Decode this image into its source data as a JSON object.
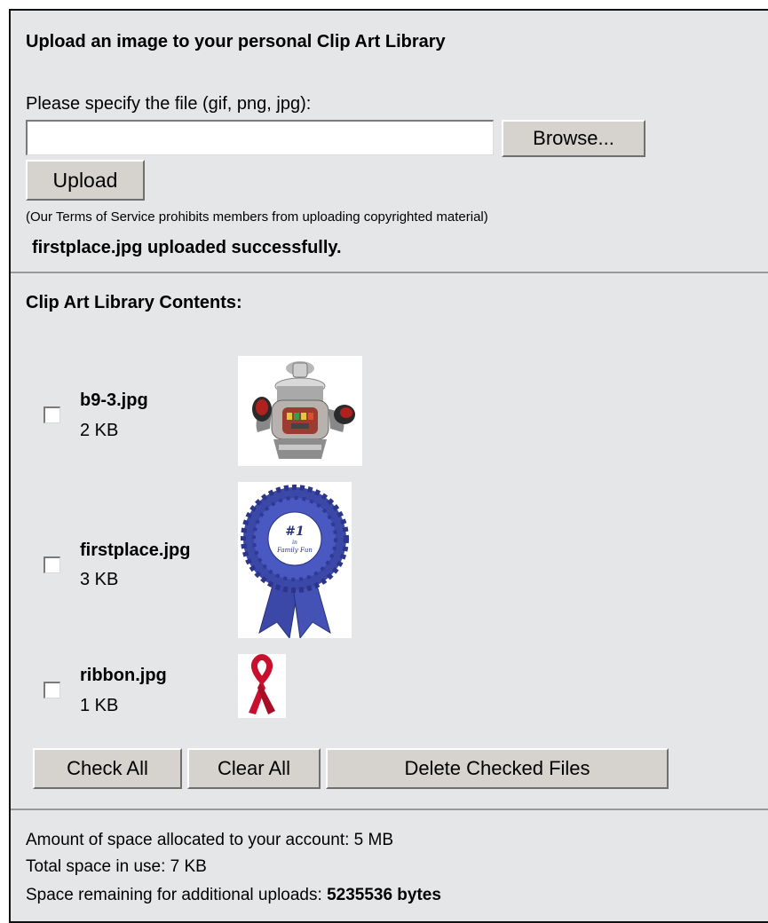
{
  "upload": {
    "title": "Upload an image to your personal Clip Art Library",
    "file_label": "Please specify the file (gif, png, jpg):",
    "file_value": "",
    "browse_label": "Browse...",
    "upload_label": "Upload",
    "tos_note": "(Our Terms of Service prohibits members from uploading copyrighted material)",
    "status_message": "firstplace.jpg uploaded successfully."
  },
  "library": {
    "title": "Clip Art Library Contents:",
    "files": [
      {
        "name": "b9-3.jpg",
        "size": "2 KB",
        "thumbnail": "robot-image",
        "checked": false
      },
      {
        "name": "firstplace.jpg",
        "size": "3 KB",
        "thumbnail": "blue-ribbon-award-image",
        "checked": false
      },
      {
        "name": "ribbon.jpg",
        "size": "1 KB",
        "thumbnail": "red-awareness-ribbon-image",
        "checked": false
      }
    ],
    "check_all_label": "Check All",
    "clear_all_label": "Clear All",
    "delete_label": "Delete Checked Files"
  },
  "footer": {
    "allocated_text": "Amount of space allocated to your account: 5 MB",
    "in_use_text": "Total space in use: 7 KB",
    "remaining_prefix": "Space remaining for additional uploads: ",
    "remaining_value": "5235536 bytes"
  },
  "colors": {
    "panel_background": "#e4e6e8",
    "button_face": "#d6d3ce",
    "ribbon_blue": "#3b48a8",
    "ribbon_red": "#c8102e"
  }
}
